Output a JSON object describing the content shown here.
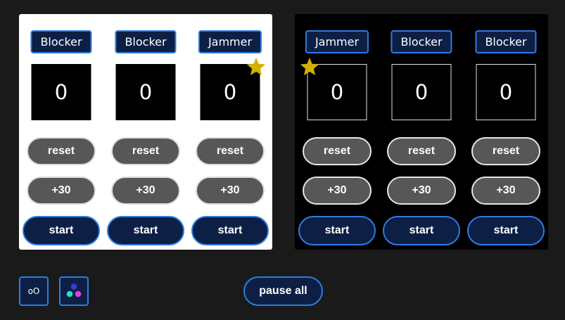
{
  "teams": [
    {
      "theme": "light",
      "star_on_player": 2,
      "players": [
        {
          "role": "Blocker",
          "counter": "0",
          "reset_label": "reset",
          "plus_label": "+30",
          "start_label": "start"
        },
        {
          "role": "Blocker",
          "counter": "0",
          "reset_label": "reset",
          "plus_label": "+30",
          "start_label": "start"
        },
        {
          "role": "Jammer",
          "counter": "0",
          "reset_label": "reset",
          "plus_label": "+30",
          "start_label": "start"
        }
      ]
    },
    {
      "theme": "dark",
      "star_on_player": 0,
      "players": [
        {
          "role": "Jammer",
          "counter": "0",
          "reset_label": "reset",
          "plus_label": "+30",
          "start_label": "start"
        },
        {
          "role": "Blocker",
          "counter": "0",
          "reset_label": "reset",
          "plus_label": "+30",
          "start_label": "start"
        },
        {
          "role": "Blocker",
          "counter": "0",
          "reset_label": "reset",
          "plus_label": "+30",
          "start_label": "start"
        }
      ]
    }
  ],
  "footer": {
    "view_toggle_label": "oO",
    "color_picker_icon": "three-dots-palette-icon",
    "pause_all_label": "pause all"
  },
  "colors": {
    "background": "#1a1a1a",
    "accent_blue": "#2e7ce0",
    "button_navy": "#0d1f45",
    "pill_gray": "#575757",
    "star_gold": "#d4b000",
    "dot_blue": "#3a3ae0",
    "dot_cyan": "#22e0c0",
    "dot_magenta": "#e040e0"
  }
}
